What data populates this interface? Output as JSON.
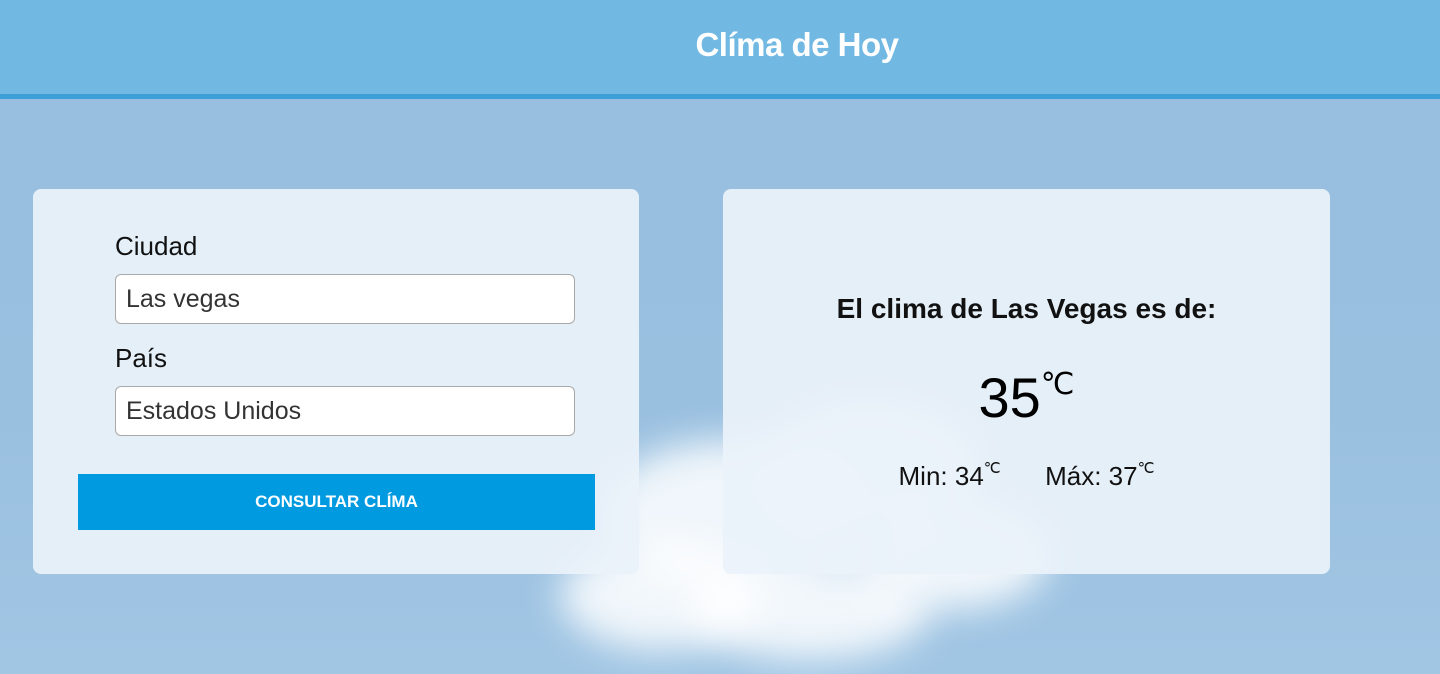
{
  "header": {
    "title": "Clíma de Hoy"
  },
  "form": {
    "city_label": "Ciudad",
    "city_value": "Las vegas",
    "country_label": "País",
    "country_value": "Estados Unidos",
    "submit_label": "CONSULTAR CLÍMA"
  },
  "result": {
    "title": "El clima de Las Vegas es de:",
    "temperature": "35",
    "unit": "℃",
    "min_label": "Min: 34",
    "max_label": "Máx: 37",
    "min_unit": "℃",
    "max_unit": "℃"
  },
  "colors": {
    "header_bg": "#71b9e3",
    "header_border": "#3d9fd8",
    "button_bg": "#009ae0",
    "card_bg": "#ebf2fa"
  }
}
